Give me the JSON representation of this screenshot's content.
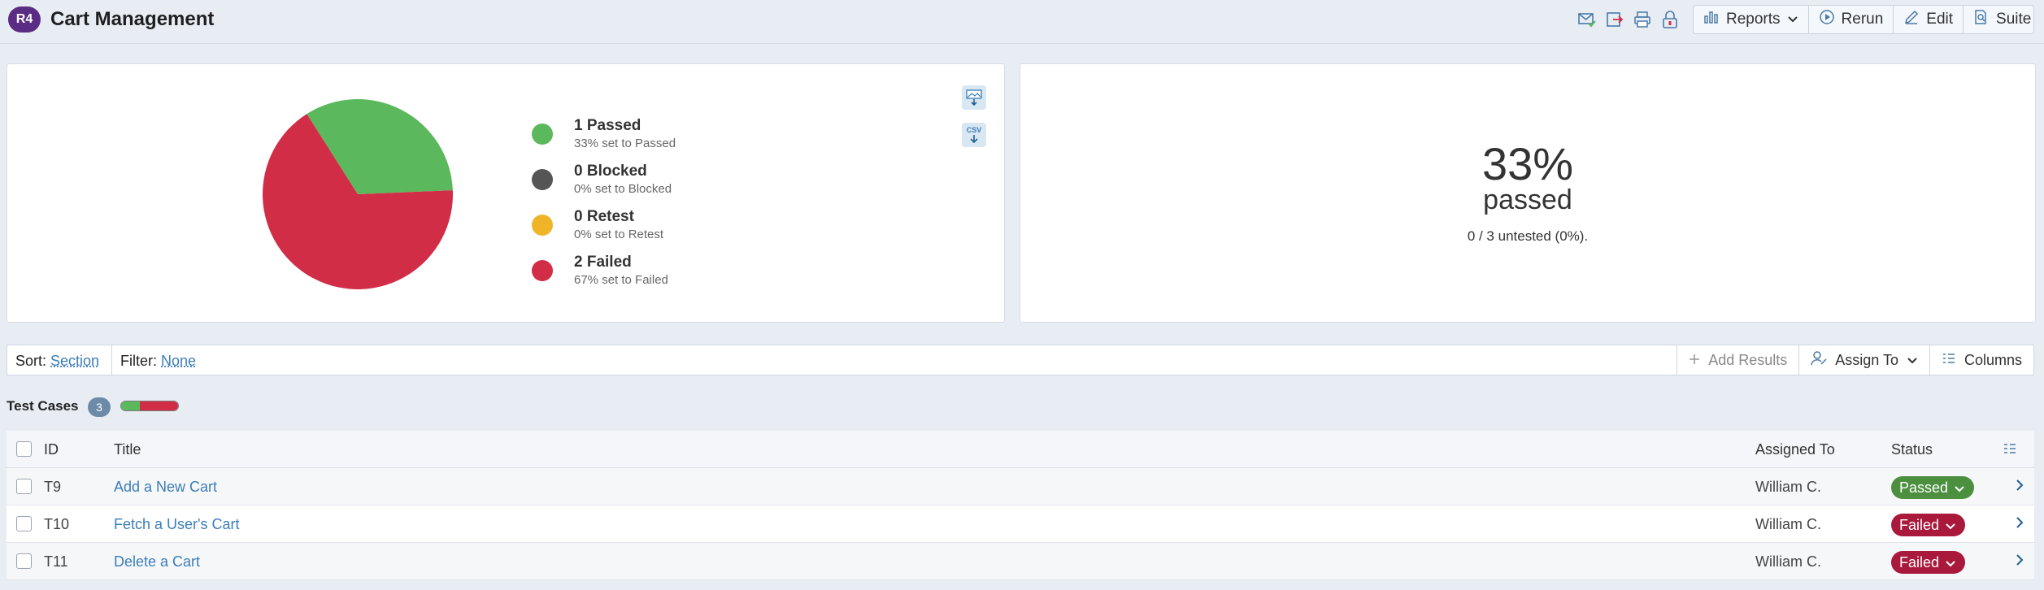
{
  "header": {
    "badge": "R4",
    "title": "Cart Management",
    "icons": [
      "envelope-check-icon",
      "export-icon",
      "print-icon",
      "lock-icon"
    ],
    "toolbar": {
      "reports_label": "Reports",
      "rerun_label": "Rerun",
      "edit_label": "Edit",
      "suite_label": "Suite"
    }
  },
  "chart_data": {
    "type": "pie",
    "categories": [
      "Passed",
      "Blocked",
      "Retest",
      "Failed"
    ],
    "values": [
      1,
      0,
      0,
      2
    ],
    "colors": [
      "#5cb85c",
      "#555555",
      "#f0b429",
      "#d12d47"
    ]
  },
  "legend": [
    {
      "label": "1 Passed",
      "sub": "33% set to Passed",
      "color": "#5cb85c"
    },
    {
      "label": "0 Blocked",
      "sub": "0% set to Blocked",
      "color": "#555555"
    },
    {
      "label": "0 Retest",
      "sub": "0% set to Retest",
      "color": "#f0b429"
    },
    {
      "label": "2 Failed",
      "sub": "67% set to Failed",
      "color": "#d12d47"
    }
  ],
  "export": {
    "image_icon": "export-image-icon",
    "csv_label": "CSV"
  },
  "summary": {
    "percent": "33%",
    "label": "passed",
    "untested": "0 / 3 untested (0%)."
  },
  "filterbar": {
    "sort_label": "Sort:",
    "sort_value": "Section",
    "filter_label": "Filter:",
    "filter_value": "None",
    "add_results": "Add Results",
    "assign_to": "Assign To",
    "columns": "Columns"
  },
  "section": {
    "title": "Test Cases",
    "count": "3",
    "progress": {
      "passed": 0.33,
      "failed": 0.67
    }
  },
  "table": {
    "headers": {
      "id": "ID",
      "title": "Title",
      "assigned": "Assigned To",
      "status": "Status"
    },
    "rows": [
      {
        "id": "T9",
        "title": "Add a New Cart",
        "assigned": "William C.",
        "status": "Passed"
      },
      {
        "id": "T10",
        "title": "Fetch a User's Cart",
        "assigned": "William C.",
        "status": "Failed"
      },
      {
        "id": "T11",
        "title": "Delete a Cart",
        "assigned": "William C.",
        "status": "Failed"
      }
    ]
  },
  "colors": {
    "passed": "#4b8f3f",
    "failed": "#a8193b",
    "link": "#3b7db8",
    "badge": "#5b2c83"
  }
}
